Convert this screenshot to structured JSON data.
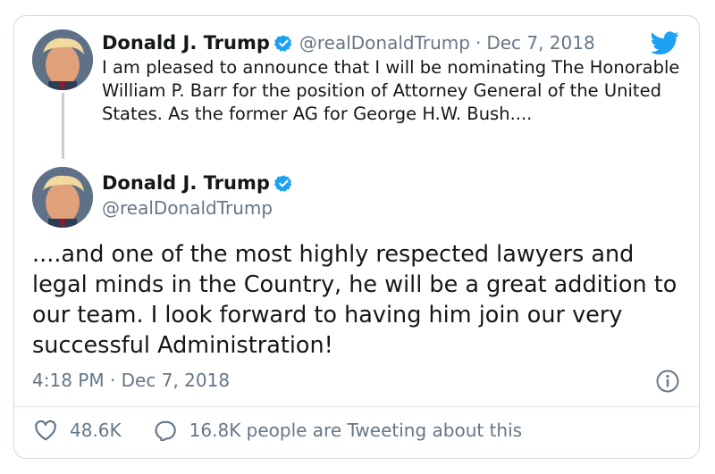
{
  "quoted_tweet": {
    "author_name": "Donald J. Trump",
    "handle": "@realDonaldTrump",
    "separator": "·",
    "date": "Dec 7, 2018",
    "text": "I am pleased to announce that I will be nominating The Honorable William P. Barr for the position of Attorney General of the United States. As the former AG for George H.W. Bush...."
  },
  "tweet": {
    "author_name": "Donald J. Trump",
    "handle": "@realDonaldTrump",
    "text": "....and one of the most highly respected lawyers and legal minds in the Country, he will be a great addition to our team. I look forward to having him join our very successful Administration!",
    "timestamp": "4:18 PM · Dec 7, 2018"
  },
  "actions": {
    "likes": "48.6K",
    "conversation": "16.8K people are Tweeting about this"
  },
  "icons": {
    "verified": "verified-badge-icon",
    "brand": "twitter-bird-icon",
    "info": "info-icon",
    "like": "heart-icon",
    "reply": "speech-bubble-icon"
  },
  "colors": {
    "brand_blue": "#1da1f2",
    "text": "#14171a",
    "secondary": "#657786",
    "border": "#cfd9de"
  }
}
